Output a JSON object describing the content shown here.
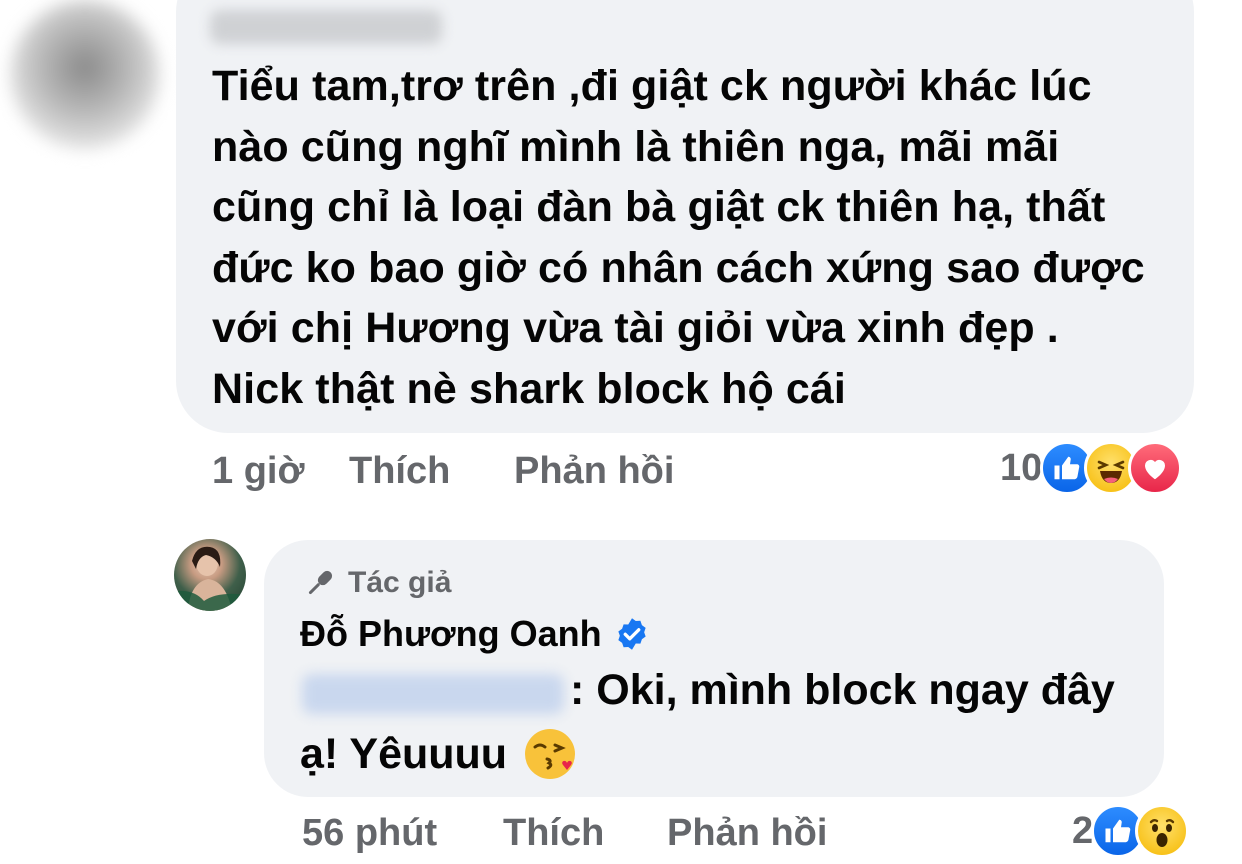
{
  "comment1": {
    "lines": [
      "Tiểu tam,trơ trên ,đi giật ck người khác lúc",
      "nào cũng nghĩ mình là thiên nga, mãi mãi",
      "cũng chỉ là loại đàn bà giật ck thiên hạ, thất",
      "đức ko bao giờ có nhân cách xứng sao được",
      "với chị Hương vừa tài giỏi vừa xinh đẹp .",
      "Nick thật nè shark block hộ cái"
    ],
    "time": "1 giờ",
    "like_label": "Thích",
    "reply_label": "Phản hồi",
    "reaction_count": "10",
    "reactions": [
      "like-icon",
      "haha-icon",
      "love-icon"
    ]
  },
  "comment2": {
    "badge": "Tác giả",
    "author": "Đỗ Phương Oanh",
    "text_line1": ": Oki, mình block ngay đây",
    "text_line2": "ạ! Yêuuuu",
    "time": "56 phút",
    "like_label": "Thích",
    "reply_label": "Phản hồi",
    "reaction_count": "2",
    "reactions": [
      "like-icon",
      "wow-icon"
    ]
  },
  "colors": {
    "bubble": "#f0f2f5",
    "secondary_text": "#65676b",
    "like_blue": "#1877f2"
  }
}
